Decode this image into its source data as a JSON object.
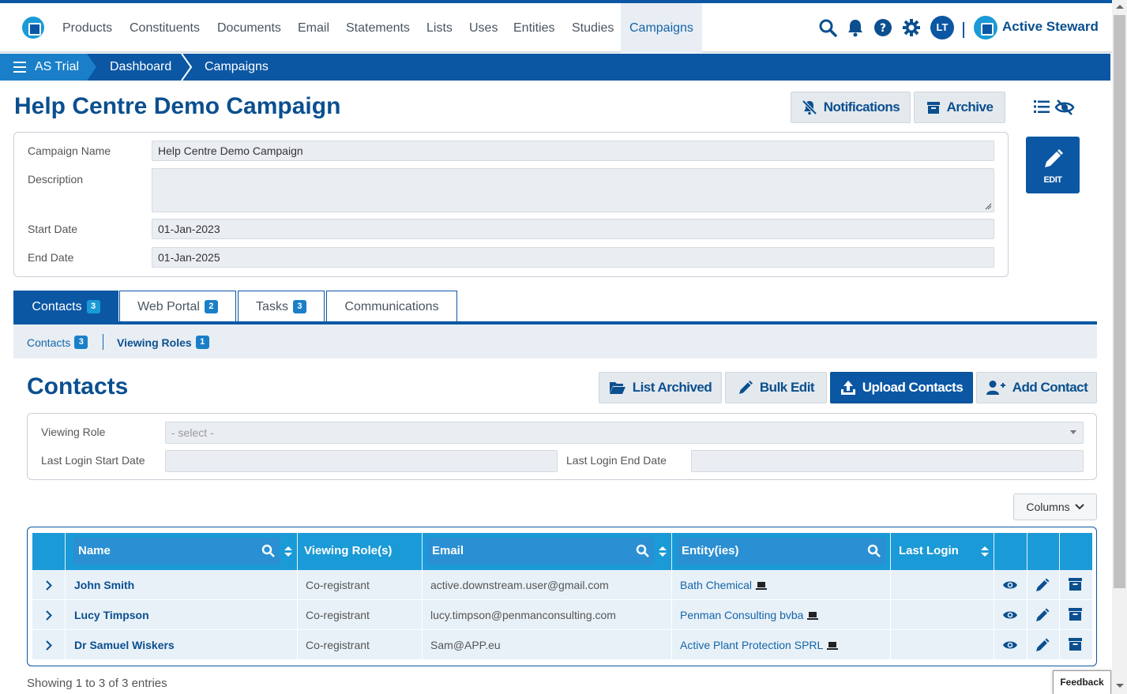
{
  "nav": {
    "items": [
      "Products",
      "Constituents",
      "Documents",
      "Email",
      "Statements",
      "Lists",
      "Uses",
      "Entities",
      "Studies",
      "Campaigns"
    ],
    "active": "Campaigns",
    "avatar_initials": "LT",
    "brand": "Active Steward"
  },
  "breadcrumb": {
    "items": [
      "AS Trial",
      "Dashboard",
      "Campaigns"
    ]
  },
  "page": {
    "title": "Help Centre Demo Campaign",
    "notifications_label": "Notifications",
    "archive_label": "Archive",
    "edit_label": "EDIT"
  },
  "campaign": {
    "name_label": "Campaign Name",
    "name_value": "Help Centre Demo Campaign",
    "description_label": "Description",
    "description_value": "",
    "start_label": "Start Date",
    "start_value": "01-Jan-2023",
    "end_label": "End Date",
    "end_value": "01-Jan-2025"
  },
  "tabs": [
    {
      "label": "Contacts",
      "badge": "3"
    },
    {
      "label": "Web Portal",
      "badge": "2"
    },
    {
      "label": "Tasks",
      "badge": "3"
    },
    {
      "label": "Communications",
      "badge": ""
    }
  ],
  "subnav": [
    {
      "label": "Contacts",
      "badge": "3"
    },
    {
      "label": "Viewing Roles",
      "badge": "1"
    }
  ],
  "contacts": {
    "title": "Contacts",
    "list_archived": "List Archived",
    "bulk_edit": "Bulk Edit",
    "upload_contacts": "Upload Contacts",
    "add_contact": "Add Contact",
    "filter": {
      "viewing_role_label": "Viewing Role",
      "viewing_role_placeholder": "- select -",
      "last_login_start_label": "Last Login Start Date",
      "last_login_end_label": "Last Login End Date"
    },
    "columns_button": "Columns",
    "table": {
      "headers": [
        "Name",
        "Viewing Role(s)",
        "Email",
        "Entity(ies)",
        "Last Login"
      ],
      "rows": [
        {
          "name": "John Smith",
          "role": "Co-registrant",
          "email": "active.downstream.user@gmail.com",
          "entity": "Bath Chemical",
          "last_login": ""
        },
        {
          "name": "Lucy Timpson",
          "role": "Co-registrant",
          "email": "lucy.timpson@penmanconsulting.com",
          "entity": "Penman Consulting bvba",
          "last_login": ""
        },
        {
          "name": "Dr Samuel Wiskers",
          "role": "Co-registrant",
          "email": "Sam@APP.eu",
          "entity": "Active Plant Protection SPRL",
          "last_login": ""
        }
      ]
    },
    "footer": "Showing 1 to 3 of 3 entries"
  },
  "feedback_label": "Feedback",
  "colors": {
    "primary": "#0b57a4",
    "accent": "#1a9ad6",
    "title": "#0b4f8f"
  }
}
